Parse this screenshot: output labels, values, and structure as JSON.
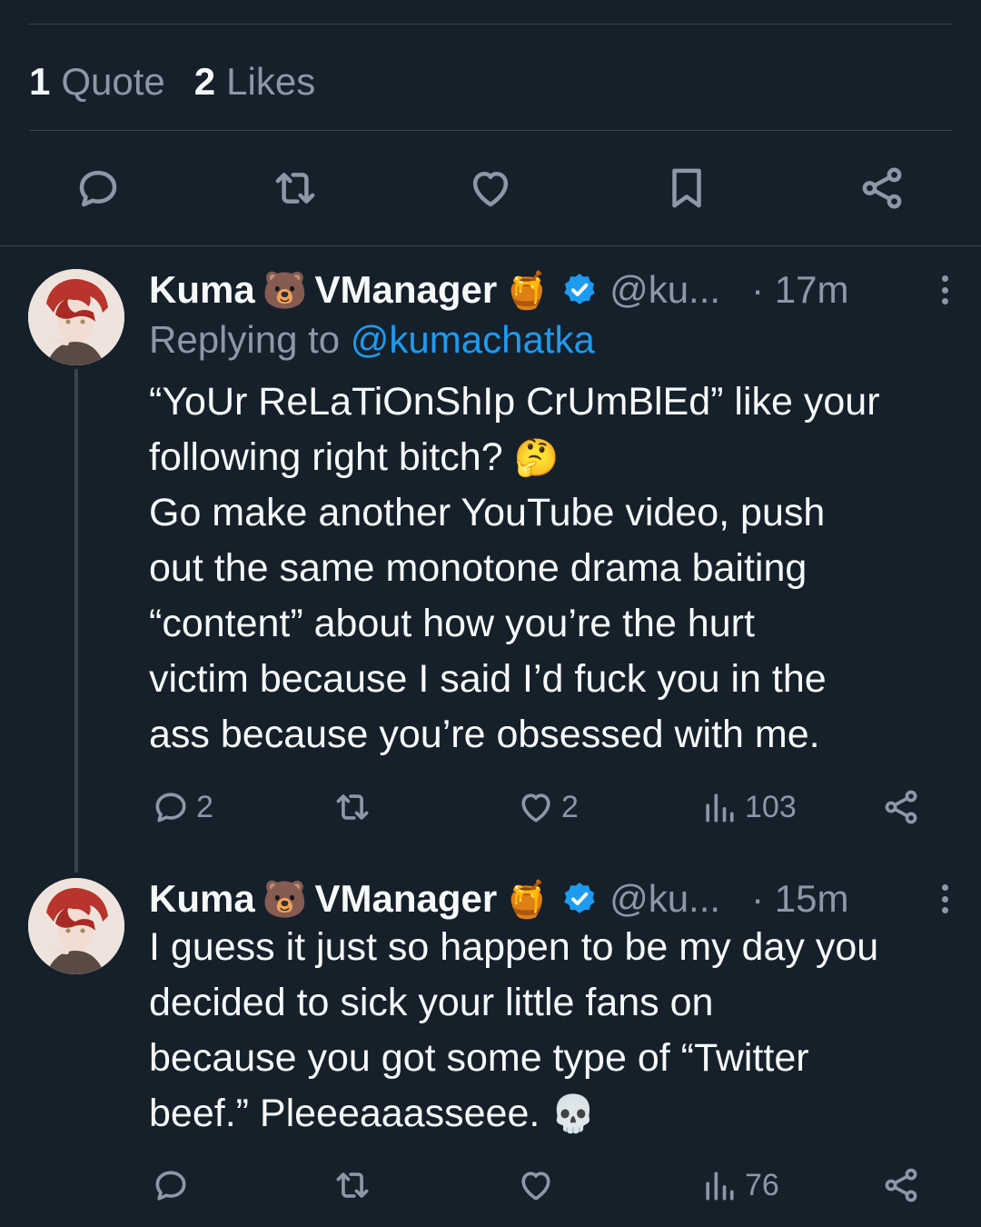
{
  "stats": {
    "quote_count": "1",
    "quote_label": "Quote",
    "likes_count": "2",
    "likes_label": "Likes"
  },
  "action_bar": {
    "icons": [
      "reply-icon",
      "retweet-icon",
      "like-icon",
      "bookmark-icon",
      "share-icon"
    ]
  },
  "tweets": [
    {
      "display_name": "Kuma",
      "emoji_bear": "🐻",
      "display_name_2": "VManager",
      "emoji_honey": "🍯",
      "handle": "@ku...",
      "time": "· 17m",
      "replying_prefix": "Replying to ",
      "replying_to": "@kumachatka",
      "lines": [
        "“YoUr ReLaTiOnShIp CrUmBlEd” like your",
        "following right bitch?",
        "Go make another YouTube video, push",
        "out the same monotone drama baiting",
        "“content” about how you’re the hurt",
        "victim because I said I’d fuck you in the",
        "ass because you’re obsessed with me."
      ],
      "line2_emoji": "🤔",
      "replies": "2",
      "likes": "2",
      "views": "103"
    },
    {
      "display_name": "Kuma",
      "emoji_bear": "🐻",
      "display_name_2": "VManager",
      "emoji_honey": "🍯",
      "handle": "@ku...",
      "time": "· 15m",
      "lines": [
        "I guess it just so happen to be my day you",
        "decided to sick your little fans on",
        "because you got some type of “Twitter",
        "beef.” Pleeeaaasseee."
      ],
      "last_line_emoji": "💀",
      "views": "76"
    }
  ],
  "colors": {
    "background": "#15202b",
    "text": "#f7f9f9",
    "muted": "#8b98a5",
    "accent": "#1d9bf0",
    "divider": "#38444d"
  }
}
